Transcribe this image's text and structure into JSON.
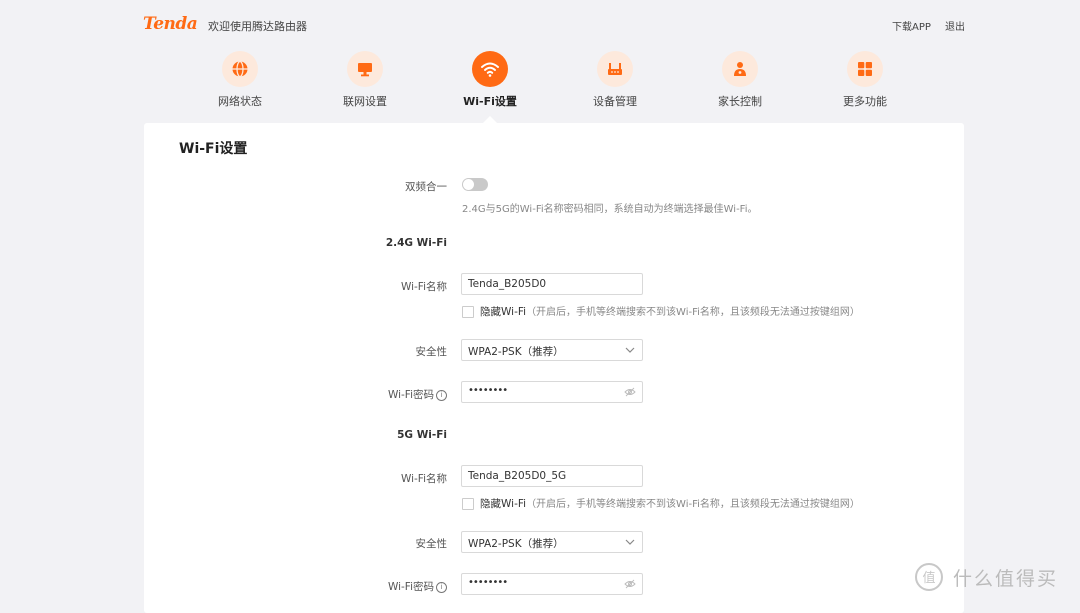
{
  "header": {
    "logo": "Tenda",
    "welcome": "欢迎使用腾达路由器",
    "download_app": "下载APP",
    "logout": "退出"
  },
  "nav": {
    "items": [
      {
        "label": "网络状态",
        "icon": "globe-icon"
      },
      {
        "label": "联网设置",
        "icon": "monitor-icon"
      },
      {
        "label": "Wi-Fi设置",
        "icon": "wifi-icon",
        "active": true
      },
      {
        "label": "设备管理",
        "icon": "router-icon"
      },
      {
        "label": "家长控制",
        "icon": "parent-icon"
      },
      {
        "label": "更多功能",
        "icon": "grid-icon"
      }
    ]
  },
  "panel": {
    "title": "Wi-Fi设置",
    "dual_band": {
      "label": "双频合一",
      "enabled": false,
      "hint": "2.4G与5G的Wi-Fi名称密码相同，系统自动为终端选择最佳Wi-Fi。"
    },
    "band_24": {
      "section_label": "2.4G Wi-Fi",
      "name_label": "Wi-Fi名称",
      "name_value": "Tenda_B205D0",
      "hide_label": "隐藏Wi-Fi",
      "hide_note": "（开启后，手机等终端搜索不到该Wi-Fi名称，且该频段无法通过按键组网）",
      "security_label": "安全性",
      "security_value": "WPA2-PSK（推荐）",
      "password_label": "Wi-Fi密码",
      "password_value": "••••••••"
    },
    "band_5": {
      "section_label": "5G Wi-Fi",
      "name_label": "Wi-Fi名称",
      "name_value": "Tenda_B205D0_5G",
      "hide_label": "隐藏Wi-Fi",
      "hide_note": "（开启后，手机等终端搜索不到该Wi-Fi名称，且该频段无法通过按键组网）",
      "security_label": "安全性",
      "security_value": "WPA2-PSK（推荐）",
      "password_label": "Wi-Fi密码",
      "password_value": "••••••••"
    }
  },
  "watermark": "什么值得买",
  "colors": {
    "accent": "#ff6a14",
    "accent_light": "#fde9dc",
    "background": "#f2f2f5"
  }
}
